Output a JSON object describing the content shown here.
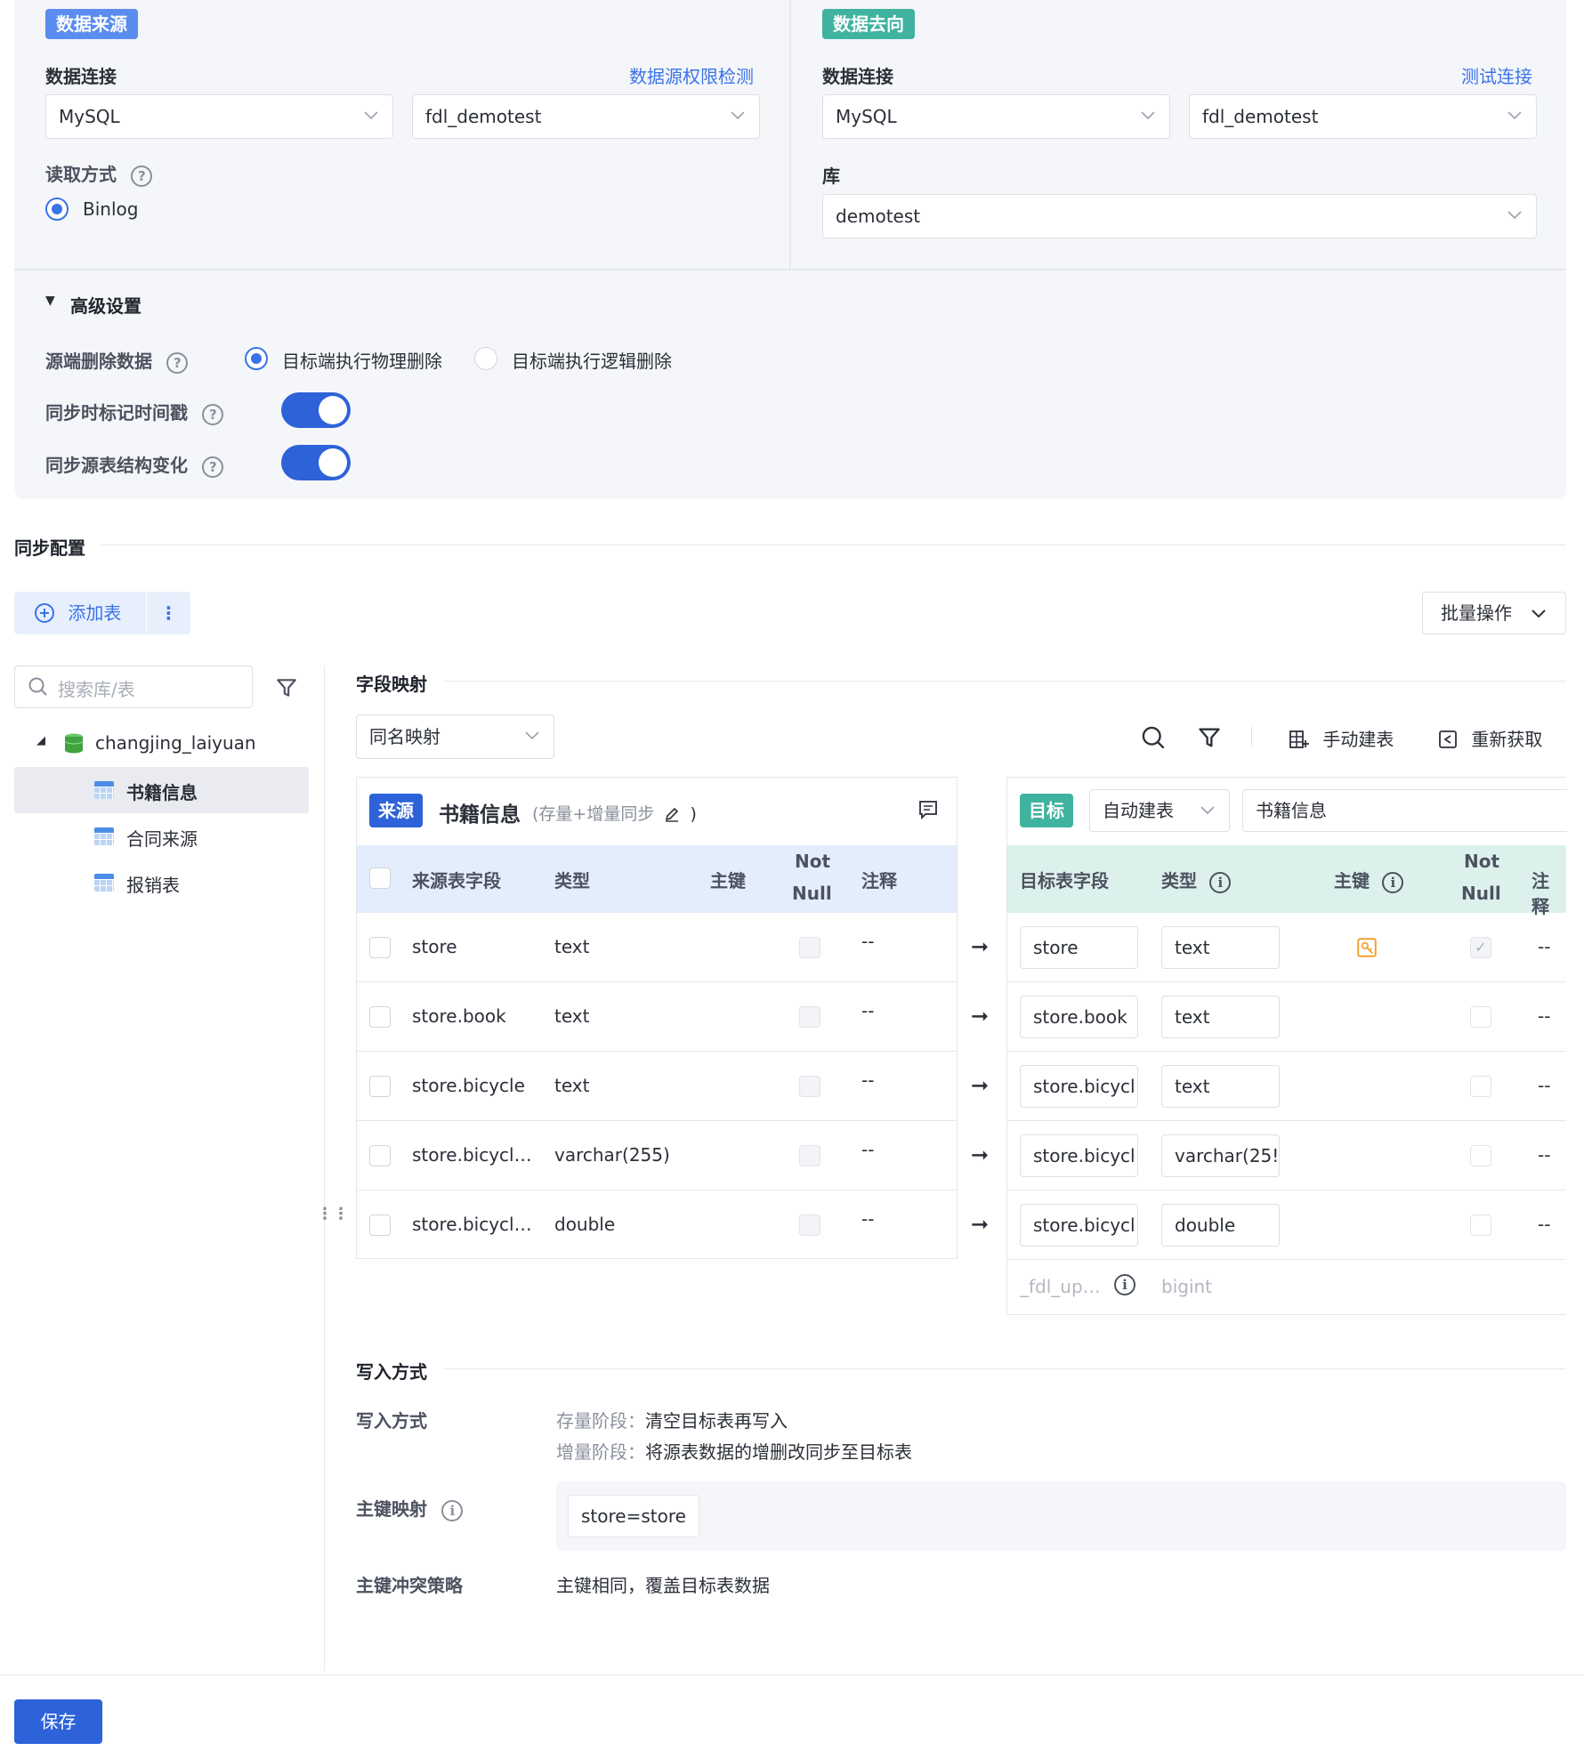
{
  "source": {
    "tag": "数据来源",
    "conn_label": "数据连接",
    "perm_link": "数据源权限检测",
    "db_type": "MySQL",
    "db_name": "fdl_demotest",
    "read_label": "读取方式",
    "read_mode": "Binlog"
  },
  "target": {
    "tag": "数据去向",
    "conn_label": "数据连接",
    "test_link": "测试连接",
    "db_type": "MySQL",
    "db_name": "fdl_demotest",
    "lib_label": "库",
    "lib_value": "demotest"
  },
  "advanced": {
    "title": "高级设置",
    "delete_label": "源端删除数据",
    "opt_physical": "目标端执行物理删除",
    "opt_logical": "目标端执行逻辑删除",
    "timestamp_label": "同步时标记时间戳",
    "schema_label": "同步源表结构变化"
  },
  "sync": {
    "title": "同步配置",
    "add_table": "添加表",
    "batch": "批量操作",
    "search_placeholder": "搜索库/表",
    "db_node": "changjing_laiyuan",
    "tables": [
      "书籍信息",
      "合同来源",
      "报销表"
    ]
  },
  "mapping": {
    "title": "字段映射",
    "mode": "同名映射",
    "manual_create": "手动建表",
    "refetch": "重新获取",
    "src_tag": "来源",
    "src_table": "书籍信息",
    "src_mode": "(存量+增量同步",
    "src_mode_close": ")",
    "tgt_tag": "目标",
    "tgt_create": "自动建表",
    "tgt_table": "书籍信息",
    "src_headers": [
      "来源表字段",
      "类型",
      "主键",
      "Not",
      "Null",
      "注释"
    ],
    "tgt_headers": [
      "目标表字段",
      "类型",
      "主键",
      "Not",
      "Null",
      "注释"
    ],
    "rows": [
      {
        "src_field": "store",
        "src_type": "text",
        "comment": "--",
        "tgt_field": "store",
        "tgt_type": "text",
        "tgt_comment": "--"
      },
      {
        "src_field": "store.book",
        "src_type": "text",
        "comment": "--",
        "tgt_field": "store.book",
        "tgt_type": "text",
        "tgt_comment": "--"
      },
      {
        "src_field": "store.bicycle",
        "src_type": "text",
        "comment": "--",
        "tgt_field": "store.bicycl",
        "tgt_type": "text",
        "tgt_comment": "--"
      },
      {
        "src_field": "store.bicycl…",
        "src_type": "varchar(255)",
        "comment": "--",
        "tgt_field": "store.bicycl",
        "tgt_type": "varchar(25!",
        "tgt_comment": "--"
      },
      {
        "src_field": "store.bicycl…",
        "src_type": "double",
        "comment": "--",
        "tgt_field": "store.bicycl",
        "tgt_type": "double",
        "tgt_comment": "--"
      }
    ],
    "extra_field": "_fdl_up…",
    "extra_type": "bigint"
  },
  "write": {
    "title": "写入方式",
    "mode_label": "写入方式",
    "stock_line": "存量阶段：",
    "stock_value": "清空目标表再写入",
    "incr_line": "增量阶段：",
    "incr_value": "将源表数据的增删改同步至目标表",
    "pk_label": "主键映射",
    "pk_value": "store=store",
    "conflict_label": "主键冲突策略",
    "conflict_value": "主键相同，覆盖目标表数据"
  },
  "footer": {
    "save": "保存"
  },
  "colors": {
    "primary": "#2e62d9",
    "source_tag": "#3a73e8",
    "target_tag": "#3fb39f",
    "pk_icon": "#f0a030"
  }
}
